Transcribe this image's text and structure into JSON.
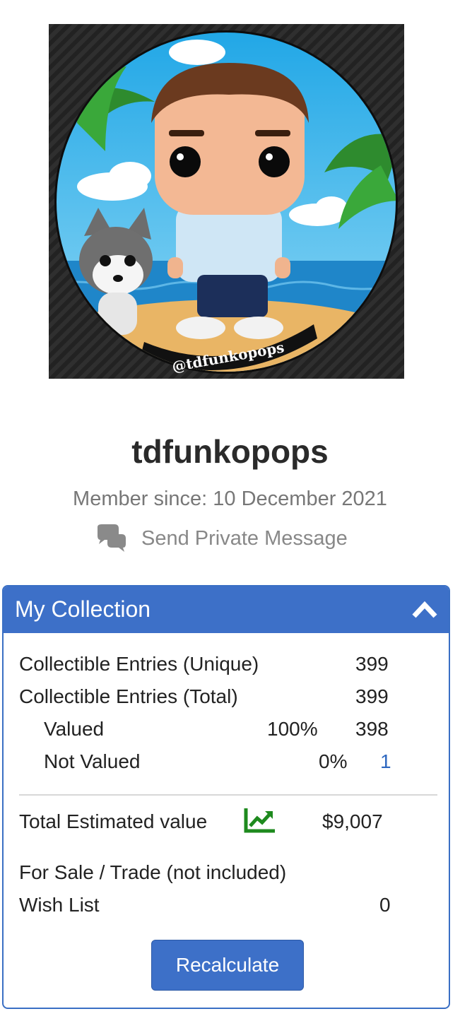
{
  "profile": {
    "username": "tdfunkopops",
    "member_since": "Member since: 10 December 2021",
    "send_message_label": "Send Private Message",
    "avatar_watermark": "@tdfunkopops"
  },
  "collection": {
    "title": "My Collection",
    "rows": {
      "unique_label": "Collectible Entries (Unique)",
      "unique_value": "399",
      "total_label": "Collectible Entries (Total)",
      "total_value": "399",
      "valued_label": "Valued",
      "valued_percent": "100%",
      "valued_value": "398",
      "not_valued_label": "Not Valued",
      "not_valued_percent": "0%",
      "not_valued_value": "1",
      "estimated_label": "Total Estimated value",
      "estimated_value": "$9,007",
      "for_sale_label": "For Sale / Trade (not included)",
      "wish_list_label": "Wish List",
      "wish_list_value": "0"
    },
    "recalculate_label": "Recalculate"
  },
  "icons": {
    "chat": "chat-bubbles-icon",
    "collapse": "chevron-up-icon",
    "trend": "trending-up-icon"
  },
  "colors": {
    "accent": "#3d70c8",
    "trend_green": "#1e8a1e",
    "link_blue": "#2f68c0"
  }
}
